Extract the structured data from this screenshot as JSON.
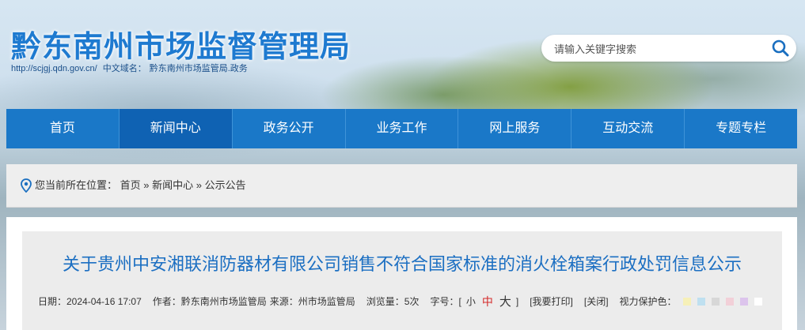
{
  "header": {
    "site_title": "黔东南州市场监督管理局",
    "url": "http://scjgj.qdn.gov.cn/",
    "cn_domain_label": "中文域名：",
    "cn_domain": "黔东南州市场监管局.政务",
    "search_placeholder": "请输入关键字搜索"
  },
  "nav": {
    "items": [
      "首页",
      "新闻中心",
      "政务公开",
      "业务工作",
      "网上服务",
      "互动交流",
      "专题专栏"
    ],
    "active_index": 1
  },
  "breadcrumb": {
    "prefix": "您当前所在位置：",
    "home": "首页",
    "sep": "»",
    "level1": "新闻中心",
    "level2": "公示公告"
  },
  "article": {
    "title": "关于贵州中安湘联消防器材有限公司销售不符合国家标准的消火栓箱案行政处罚信息公示",
    "date": "日期：2024-04-16 17:07",
    "author": "作者：黔东南州市场监管局",
    "source": "来源：州市场监管局",
    "views": "浏览量：5次",
    "font_label": "字号：[",
    "font_small": "小",
    "font_medium": "中",
    "font_large": "大",
    "font_close": "]",
    "print": "[我要打印]",
    "close": "[关闭]",
    "eye_care": "视力保护色："
  },
  "colors": {
    "primary": "#1a78c8",
    "nav_active": "#0f62b3",
    "title_blue": "#1c6fc2",
    "swatches": [
      "#f6f0b8",
      "#bfe0f0",
      "#d7d7d7",
      "#f2d0d8",
      "#dcc4ec",
      "#ffffff"
    ]
  }
}
